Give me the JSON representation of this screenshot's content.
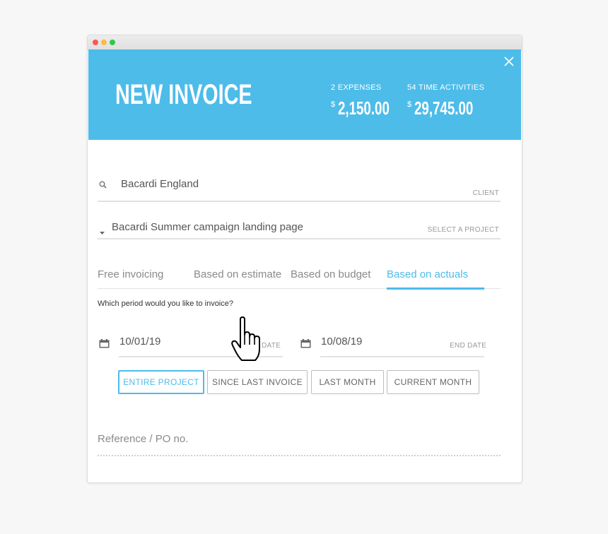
{
  "header": {
    "title": "NEW INVOICE",
    "bg_color": "#4dbce9",
    "stats": [
      {
        "label": "2 EXPENSES",
        "currency": "$",
        "amount": "2,150.00"
      },
      {
        "label": "54 TIME ACTIVITIES",
        "currency": "$",
        "amount": "29,745.00"
      }
    ],
    "close_icon": "close-icon"
  },
  "client": {
    "icon": "search-icon",
    "value": "Bacardi England",
    "hint": "CLIENT"
  },
  "project": {
    "icon": "caret-down-icon",
    "value": "Bacardi Summer campaign landing page",
    "hint": "SELECT A PROJECT"
  },
  "tabs": [
    {
      "label": "Free invoicing",
      "active": false
    },
    {
      "label": "Based on estimate",
      "active": false
    },
    {
      "label": "Based on budget",
      "active": false
    },
    {
      "label": "Based on actuals",
      "active": true
    }
  ],
  "period": {
    "question": "Which period would you like to invoice?",
    "start": {
      "icon": "calendar-icon",
      "value": "10/01/19",
      "hint": "DATE"
    },
    "end": {
      "icon": "calendar-icon",
      "value": "10/08/19",
      "hint": "END DATE"
    },
    "buttons": [
      {
        "label": "ENTIRE PROJECT",
        "active": true
      },
      {
        "label": "SINCE LAST INVOICE",
        "active": false
      },
      {
        "label": "LAST MONTH",
        "active": false
      },
      {
        "label": "CURRENT MONTH",
        "active": false
      }
    ]
  },
  "reference": {
    "placeholder": "Reference / PO no."
  },
  "accent_color": "#4dbce9"
}
